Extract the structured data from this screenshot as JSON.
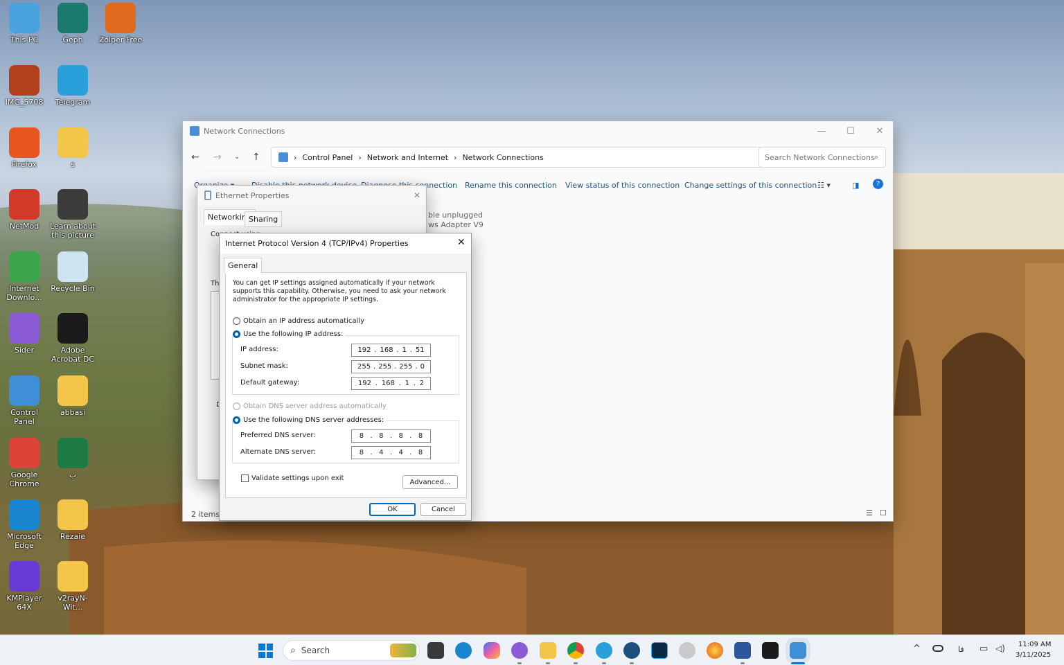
{
  "desktop": {
    "icons": [
      {
        "label": "This PC",
        "icon": "monitor-icon",
        "color": "#4aa3df"
      },
      {
        "label": "Geph",
        "icon": "geph-icon",
        "color": "#1a7a6e"
      },
      {
        "label": "Zoiper Free",
        "icon": "zoiper-icon",
        "color": "#e06a1e"
      },
      {
        "label": "IMG_5708",
        "icon": "image-file-icon",
        "color": "#b2401c"
      },
      {
        "label": "Telegram",
        "icon": "telegram-icon",
        "color": "#2aa0da"
      },
      {
        "label": "Firefox",
        "icon": "firefox-icon",
        "color": "#e8561f"
      },
      {
        "label": "s",
        "icon": "folder-icon",
        "color": "#f3c64a"
      },
      {
        "label": "NetMod",
        "icon": "netmod-icon",
        "color": "#d23a2a"
      },
      {
        "label": "Learn about this picture",
        "icon": "learn-picture-icon",
        "color": "#3b3b3b"
      },
      {
        "label": "Internet Downlo...",
        "icon": "idm-icon",
        "color": "#3aa54a"
      },
      {
        "label": "Recycle Bin",
        "icon": "recycle-bin-icon",
        "color": "#cfe4f2"
      },
      {
        "label": "Sider",
        "icon": "sider-icon",
        "color": "#8b5bd6"
      },
      {
        "label": "Adobe Acrobat DC",
        "icon": "acrobat-icon",
        "color": "#1b1b1b"
      },
      {
        "label": "Control Panel",
        "icon": "control-panel-icon",
        "color": "#3f8fd6"
      },
      {
        "label": "abbasi",
        "icon": "folder-icon",
        "color": "#f3c64a"
      },
      {
        "label": "Google Chrome",
        "icon": "chrome-icon",
        "color": "#db4437"
      },
      {
        "label": "ب",
        "icon": "excel-icon",
        "color": "#1d7a43"
      },
      {
        "label": "Microsoft Edge",
        "icon": "edge-icon",
        "color": "#1a86d0"
      },
      {
        "label": "Rezaie",
        "icon": "folder-icon",
        "color": "#f3c64a"
      },
      {
        "label": "KMPlayer 64X",
        "icon": "kmplayer-icon",
        "color": "#6a3ad6"
      },
      {
        "label": "v2rayN-Wit...",
        "icon": "folder-icon",
        "color": "#f3c64a"
      }
    ]
  },
  "network_connections": {
    "title": "Network Connections",
    "breadcrumb": [
      "Control Panel",
      "Network and Internet",
      "Network Connections"
    ],
    "search_placeholder": "Search Network Connections",
    "commands": [
      "Organize ▾",
      "Disable this network device",
      "Diagnose this connection",
      "Rename this connection",
      "View status of this connection",
      "Change settings of this connection"
    ],
    "adapter_status": "ble unplugged",
    "adapter_name": "ws Adapter V9",
    "status_count": "2 items"
  },
  "ethernet_properties": {
    "title": "Ethernet Properties",
    "tabs": [
      "Networking",
      "Sharing"
    ],
    "connect_using": "Connect using:",
    "this_connection": "Th",
    "d_label": "D"
  },
  "ipv4": {
    "title": "Internet Protocol Version 4 (TCP/IPv4) Properties",
    "tab": "General",
    "description": "You can get IP settings assigned automatically if your network supports this capability. Otherwise, you need to ask your network administrator for the appropriate IP settings.",
    "obtain_ip": "Obtain an IP address automatically",
    "use_ip": "Use the following IP address:",
    "ip_label": "IP address:",
    "ip": [
      "192",
      "168",
      "1",
      "51"
    ],
    "mask_label": "Subnet mask:",
    "mask": [
      "255",
      "255",
      "255",
      "0"
    ],
    "gw_label": "Default gateway:",
    "gw": [
      "192",
      "168",
      "1",
      "2"
    ],
    "obtain_dns": "Obtain DNS server address automatically",
    "use_dns": "Use the following DNS server addresses:",
    "pref_label": "Preferred DNS server:",
    "pref": [
      "8",
      "8",
      "8",
      "8"
    ],
    "alt_label": "Alternate DNS server:",
    "alt": [
      "8",
      "4",
      "4",
      "8"
    ],
    "validate": "Validate settings upon exit",
    "advanced": "Advanced...",
    "ok": "OK",
    "cancel": "Cancel"
  },
  "taskbar": {
    "search": "Search",
    "time": "11:09 AM",
    "date": "3/11/2025",
    "lang": "فا"
  }
}
